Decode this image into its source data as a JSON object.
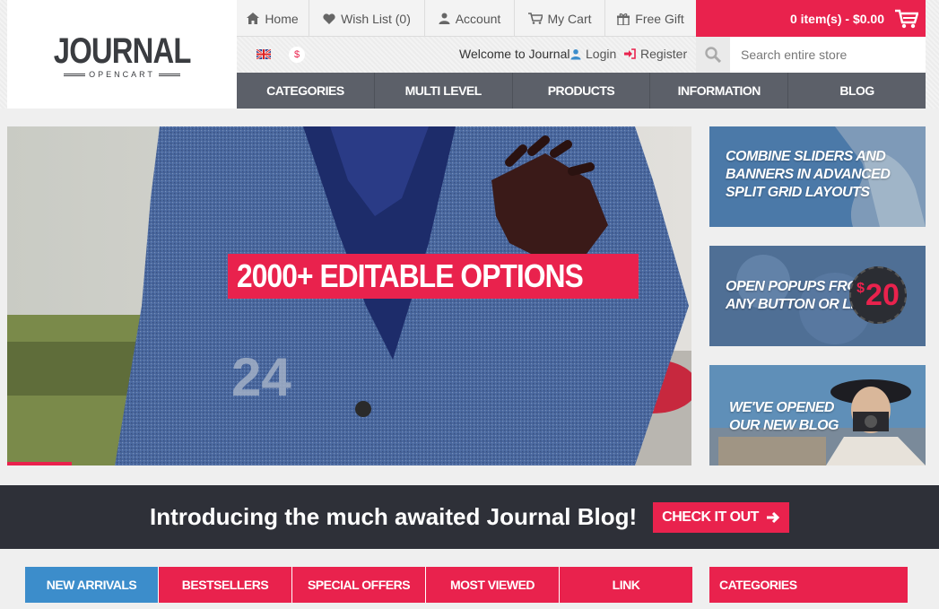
{
  "logo": {
    "main": "JOURNAL",
    "sub": "OPENCART"
  },
  "toplinks": [
    {
      "label": "Home",
      "icon": "home-icon"
    },
    {
      "label": "Wish List (0)",
      "icon": "heart-icon"
    },
    {
      "label": "Account",
      "icon": "user-icon"
    },
    {
      "label": "My Cart",
      "icon": "cart-icon"
    },
    {
      "label": "Free Gift",
      "icon": "gift-icon"
    }
  ],
  "cart": {
    "label": "0 item(s) - $0.00",
    "icon": "shopping-cart-icon"
  },
  "currency": {
    "symbol": "$"
  },
  "language": {
    "icon": "uk-flag-icon"
  },
  "header": {
    "welcome": "Welcome to Journal",
    "login": "Login",
    "register": "Register"
  },
  "search": {
    "placeholder": "Search entire store",
    "value": ""
  },
  "mainnav": [
    "CATEGORIES",
    "MULTI LEVEL",
    "PRODUCTS",
    "INFORMATION",
    "BLOG"
  ],
  "hero": {
    "caption": "2000+ EDITABLE OPTIONS",
    "jersey_number": "24"
  },
  "banners": [
    {
      "text": [
        "COMBINE SLIDERS AND",
        "BANNERS IN ADVANCED",
        "SPLIT GRID LAYOUTS"
      ]
    },
    {
      "text": [
        "OPEN POPUPS FROM",
        "ANY BUTTON OR LINK"
      ],
      "badge_currency": "$",
      "badge_value": "20"
    },
    {
      "text": [
        "WE'VE OPENED",
        "OUR NEW BLOG"
      ]
    }
  ],
  "blogstrip": {
    "title": "Introducing the much awaited Journal Blog!",
    "button": "CHECK IT OUT"
  },
  "tabs": [
    "NEW ARRIVALS",
    "BESTSELLERS",
    "SPECIAL OFFERS",
    "MOST VIEWED",
    "LINK"
  ],
  "sidebar": {
    "title": "CATEGORIES"
  },
  "colors": {
    "accent": "#e9224d",
    "nav": "#5c6069",
    "dark": "#2e3038",
    "active_tab": "#3c8dcb"
  }
}
